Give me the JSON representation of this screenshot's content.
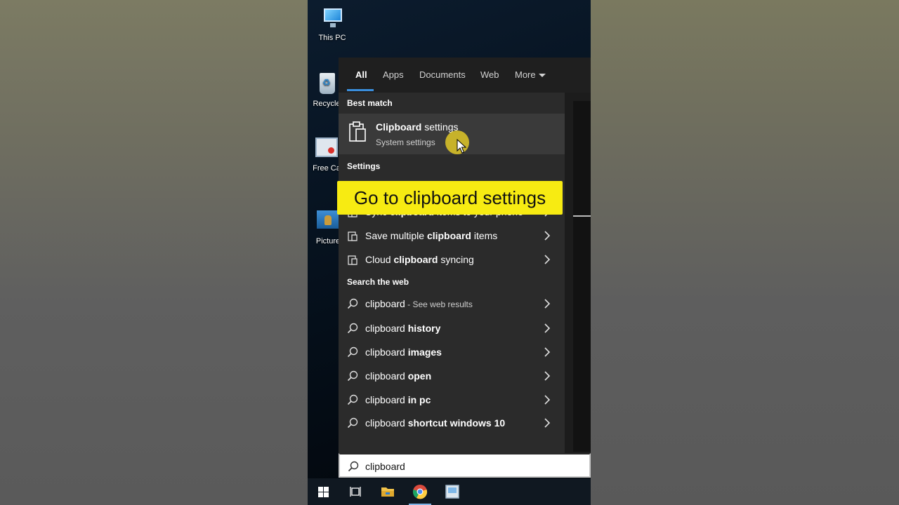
{
  "desktop": {
    "icons": [
      {
        "label": "This PC"
      },
      {
        "label": "Recycle"
      },
      {
        "label": "Free Ca"
      },
      {
        "label": "Picture"
      }
    ]
  },
  "search_tabs": {
    "all": "All",
    "apps": "Apps",
    "documents": "Documents",
    "web": "Web",
    "more": "More"
  },
  "best_match": {
    "header": "Best match",
    "title_bold": "Clipboard",
    "title_rest": " settings",
    "subtitle": "System settings"
  },
  "settings_section": {
    "header": "Settings",
    "items": [
      {
        "pre": "Sync ",
        "bold": "clipboard",
        "post": " items to your phone"
      },
      {
        "pre": "Save multiple ",
        "bold": "clipboard",
        "post": " items"
      },
      {
        "pre": "Cloud ",
        "bold": "clipboard",
        "post": " syncing"
      }
    ]
  },
  "web_section": {
    "header": "Search the web",
    "items": [
      {
        "pre": "clipboard",
        "bold": "",
        "sub": " - See web results"
      },
      {
        "pre": "clipboard ",
        "bold": "history",
        "sub": ""
      },
      {
        "pre": "clipboard ",
        "bold": "images",
        "sub": ""
      },
      {
        "pre": "clipboard ",
        "bold": "open",
        "sub": ""
      },
      {
        "pre": "clipboard ",
        "bold": "in pc",
        "sub": ""
      },
      {
        "pre": "clipboard ",
        "bold": "shortcut windows 10",
        "sub": ""
      }
    ]
  },
  "search_box": {
    "value": "clipboard"
  },
  "caption": "Go to clipboard settings",
  "colors": {
    "accent": "#3a8edc",
    "caption_bg": "#f7eb12",
    "panel_bg": "#2b2b2b",
    "highlight": "#3a3a3a"
  },
  "taskbar": {
    "icons": [
      "windows-start-icon",
      "task-view-icon",
      "file-explorer-icon",
      "chrome-icon",
      "app-icon"
    ]
  }
}
